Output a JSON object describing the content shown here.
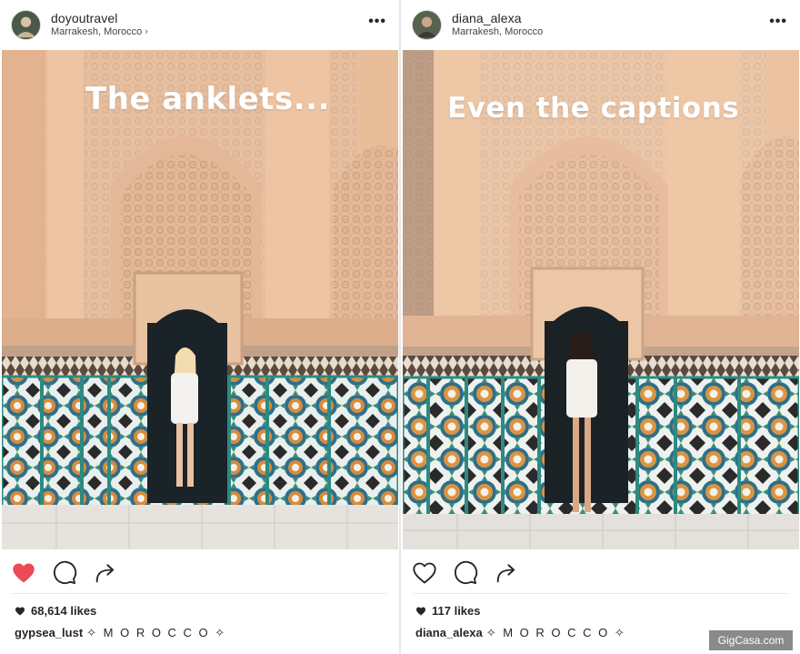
{
  "posts": [
    {
      "username": "doyoutravel",
      "location": "Marrakesh, Morocco",
      "more_label": "•••",
      "overlay_text": "The anklets...",
      "liked": true,
      "likes_text": "68,614 likes",
      "caption_user": "gypsea_lust",
      "caption_text": "✧ M O R O C C O ✧"
    },
    {
      "username": "diana_alexa",
      "location": "Marrakesh, Morocco",
      "more_label": "•••",
      "overlay_text": "Even the captions",
      "liked": false,
      "likes_text": "117 likes",
      "caption_user": "diana_alexa",
      "caption_text": "✧ M O R O C C O ✧"
    }
  ],
  "icons": {
    "like": "heart-icon",
    "comment": "comment-icon",
    "share": "share-icon",
    "more": "more-options-icon",
    "location_chevron": "chevron-right-icon"
  },
  "colors": {
    "liked_heart": "#ed4956",
    "icon_stroke": "#262626",
    "plaster": "#e8c4a6",
    "tile_teal": "#2e8a80"
  },
  "watermark": "GigCasa.com"
}
